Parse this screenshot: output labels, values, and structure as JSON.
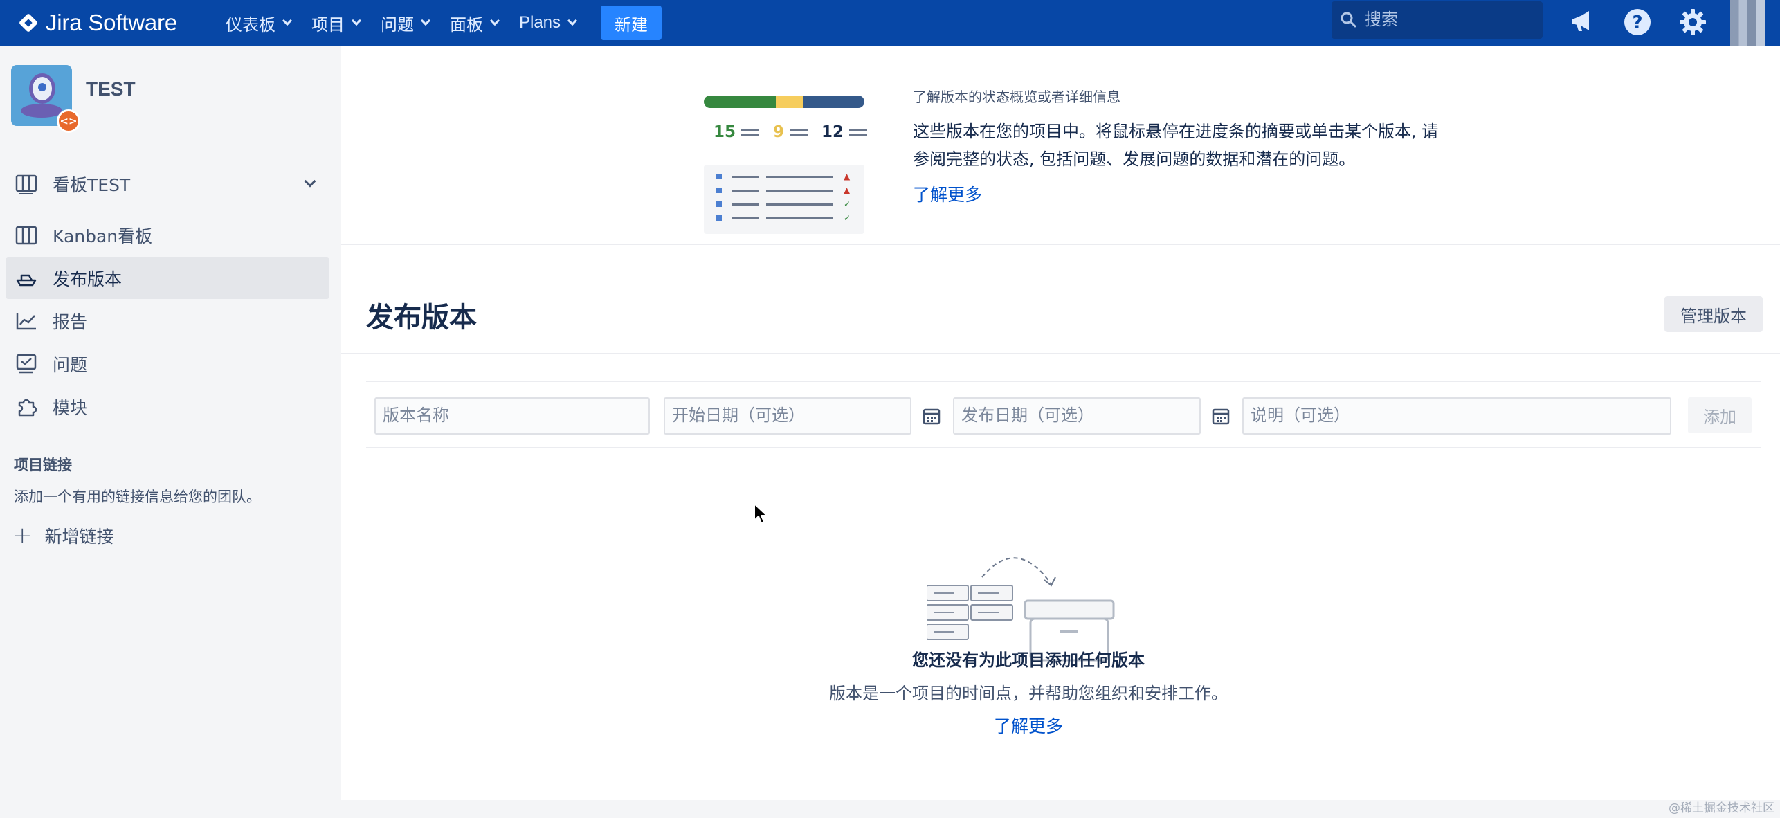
{
  "topnav": {
    "logo_text": "Jira Software",
    "menu": [
      "仪表板",
      "项目",
      "问题",
      "面板",
      "Plans"
    ],
    "create_label": "新建",
    "search_placeholder": "搜索"
  },
  "sidebar": {
    "project_name": "TEST",
    "board_selector": "看板TEST",
    "items": [
      {
        "label": "Kanban看板",
        "icon": "board-icon"
      },
      {
        "label": "发布版本",
        "icon": "ship-icon",
        "active": true
      },
      {
        "label": "报告",
        "icon": "chart-icon"
      },
      {
        "label": "问题",
        "icon": "issues-icon"
      },
      {
        "label": "模块",
        "icon": "puzzle-icon"
      }
    ],
    "links_title": "项目链接",
    "links_desc": "添加一个有用的链接信息给您的团队。",
    "add_link": "新增链接"
  },
  "info": {
    "counts": [
      "15",
      "9",
      "12"
    ],
    "title": "了解版本的状态概览或者详细信息",
    "desc": "这些版本在您的项目中。将鼠标悬停在进度条的摘要或单击某个版本, 请参阅完整的状态, 包括问题、发展问题的数据和潜在的问题。",
    "link": "了解更多"
  },
  "main": {
    "title": "发布版本",
    "manage_label": "管理版本",
    "form": {
      "name_placeholder": "版本名称",
      "start_placeholder": "开始日期（可选）",
      "release_placeholder": "发布日期（可选）",
      "desc_placeholder": "说明（可选）",
      "add_label": "添加"
    },
    "empty": {
      "title": "您还没有为此项目添加任何版本",
      "desc": "版本是一个项目的时间点，并帮助您组织和安排工作。",
      "link": "了解更多"
    }
  },
  "watermark": "@稀土掘金技术社区",
  "colors": {
    "nav_bg": "#0747a6",
    "create_btn": "#2684ff",
    "link": "#0052cc"
  }
}
